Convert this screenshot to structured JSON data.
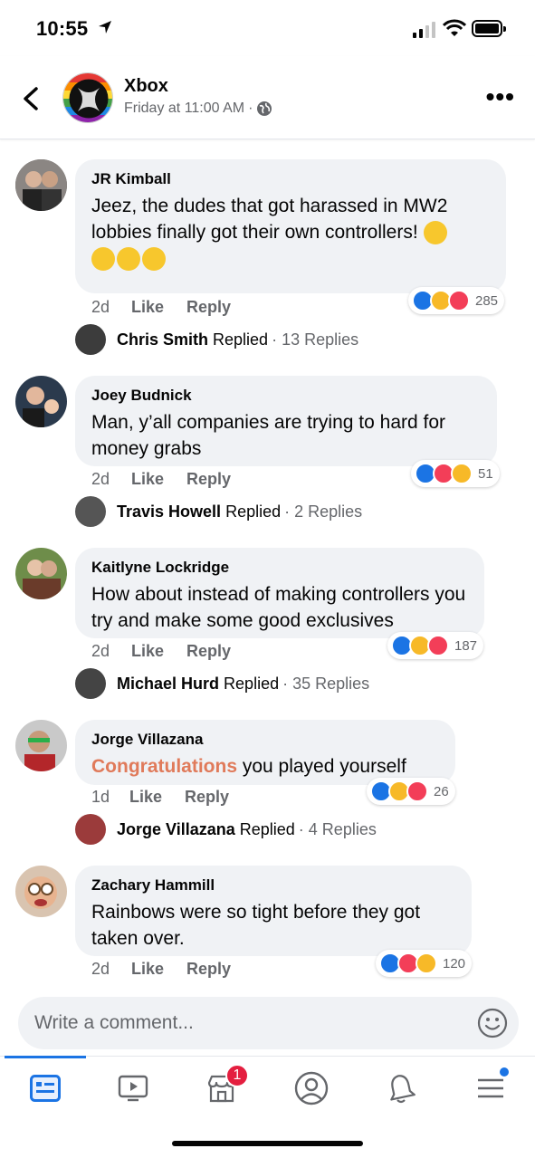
{
  "status_bar": {
    "time": "10:55"
  },
  "header": {
    "page_name": "Xbox",
    "post_time": "Friday at 11:00 AM",
    "separator": "·"
  },
  "comments": [
    {
      "author": "JR Kimball",
      "text": "Jeez, the dudes that got harassed in MW2 lobbies finally got their own controllers!",
      "time_ago": "2d",
      "like": "Like",
      "reply": "Reply",
      "reaction_count": "285",
      "replied_name": "Chris Smith",
      "replied_label": "Replied",
      "replied_count": "· 13 Replies"
    },
    {
      "author": "Joey Budnick",
      "text": "Man, y’all companies are trying to hard for money grabs",
      "time_ago": "2d",
      "like": "Like",
      "reply": "Reply",
      "reaction_count": "51",
      "replied_name": "Travis Howell",
      "replied_label": "Replied",
      "replied_count": "· 2 Replies"
    },
    {
      "author": "Kaitlyne Lockridge",
      "text": "How about instead of making controllers you try and make some good exclusives",
      "time_ago": "2d",
      "like": "Like",
      "reply": "Reply",
      "reaction_count": "187",
      "replied_name": "Michael Hurd",
      "replied_label": "Replied",
      "replied_count": "· 35 Replies"
    },
    {
      "author": "Jorge Villazana",
      "text_highlight": "Congratulations",
      "text_rest": " you played yourself",
      "time_ago": "1d",
      "like": "Like",
      "reply": "Reply",
      "reaction_count": "26",
      "replied_name": "Jorge Villazana",
      "replied_label": "Replied",
      "replied_count": "· 4 Replies"
    },
    {
      "author": "Zachary Hammill",
      "text": "Rainbows were so tight before they got taken over.",
      "time_ago": "2d",
      "like": "Like",
      "reply": "Reply",
      "reaction_count": "120"
    }
  ],
  "composer": {
    "placeholder": "Write a comment..."
  },
  "nav": {
    "marketplace_badge": "1"
  },
  "colors": {
    "facebook_blue": "#1b74e4",
    "bubble_gray": "#f0f2f5",
    "secondary_text": "#65676b",
    "highlight_text": "#e07a5a",
    "badge_red": "#e41e3f"
  }
}
